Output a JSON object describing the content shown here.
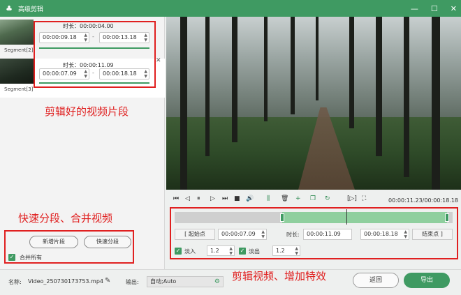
{
  "window": {
    "title": "高级剪辑"
  },
  "segments": [
    {
      "label": "Segment[2]",
      "duration": "时长：00:00:04.00",
      "start": "00:00:09.18",
      "end": "00:00:13.18"
    },
    {
      "label": "Segment[3]",
      "duration": "时长：00:00:11.09",
      "start": "00:00:07.09",
      "end": "00:00:18.18"
    }
  ],
  "annotations": {
    "segments": "剪辑好的视频片段",
    "split": "快速分段、合并视频",
    "edit": "剪辑视频、增加特效"
  },
  "left_buttons": {
    "add": "新增片段",
    "fast": "快速分段",
    "merge": "合并所有"
  },
  "controls": {
    "time": "00:00:11.23/00:00:18.18"
  },
  "range": {
    "start_label": "起始点",
    "start": "00:00:07.09",
    "duration_label": "时长:",
    "duration": "00:00:11.09",
    "end": "00:00:18.18",
    "end_label": "结束点"
  },
  "fade": {
    "in_label": "淡入",
    "in_value": "1.2",
    "out_label": "淡出",
    "out_value": "1.2"
  },
  "footer": {
    "name_label": "名称:",
    "name_value": "Video_250730173753.mp4",
    "output_label": "输出:",
    "output_value": "自动;Auto",
    "back": "返回",
    "export": "导出"
  },
  "colors": {
    "accent": "#3f9a62",
    "annotation": "#e02020"
  }
}
